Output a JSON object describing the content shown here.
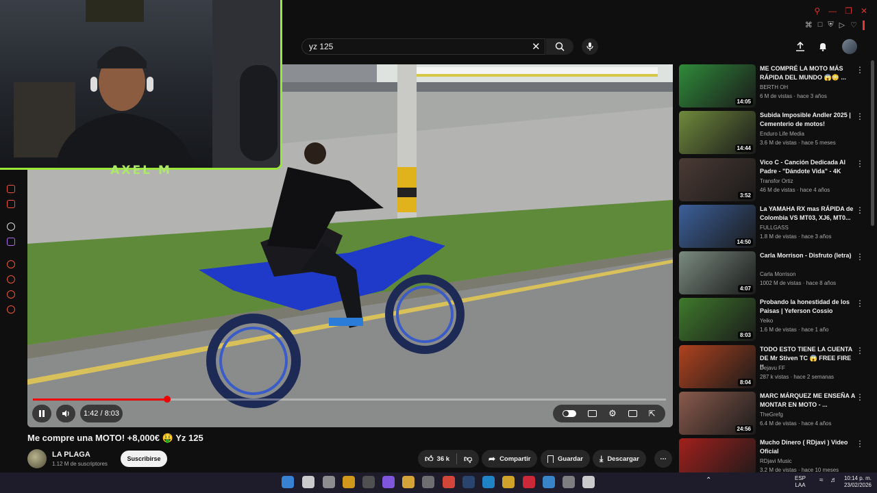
{
  "search": {
    "query": "yz 125"
  },
  "overlay": {
    "streamer_name": "AXEL M"
  },
  "player": {
    "current_time": "1:42",
    "duration": "8:03",
    "time_display": "1:42 / 8:03",
    "progress_fraction": 0.212
  },
  "video": {
    "title": "Me compre una MOTO! +8,000€ 🤑 Yz 125",
    "channel": "LA PLAGA",
    "subscribers": "1.12 M de suscriptores",
    "subscribe_label": "Suscribirse",
    "likes": "36 k",
    "share_label": "Compartir",
    "save_label": "Guardar",
    "download_label": "Descargar"
  },
  "recommendations": [
    {
      "title": "ME COMPRÉ LA MOTO MÁS RÁPIDA DEL MUNDO 😱😳 ...",
      "channel": "BERTH OH",
      "meta": "6 M de vistas · hace 3 años",
      "duration": "14:05",
      "thumb_color": "#2f8a3a"
    },
    {
      "title": "Subida Imposible Andler 2025 | Cementerio de motos!",
      "channel": "Enduro Life Media",
      "meta": "3.6 M de vistas · hace 5 meses",
      "duration": "14:44",
      "thumb_color": "#6f8a3c"
    },
    {
      "title": "Vico C - Canción Dedicada Al Padre - \"Dándote Vida\" - 4K",
      "channel": "Transfor Ortiz",
      "meta": "46 M de vistas · hace 4 años",
      "duration": "3:52",
      "thumb_color": "#4b3a34"
    },
    {
      "title": "La YAMAHA RX mas RÁPIDA de Colombia VS MT03, XJ6, MT0...",
      "channel": "FULLGASS",
      "meta": "1.8 M de vistas · hace 3 años",
      "duration": "14:50",
      "thumb_color": "#3b5f9a"
    },
    {
      "title": "Carla Morrison - Disfruto (letra)",
      "channel": "Carla Morrison",
      "meta": "1002 M de vistas · hace 8 años",
      "duration": "4:07",
      "thumb_color": "#7a8b80"
    },
    {
      "title": "Probando la honestidad de los Paisas | Yeferson Cossio",
      "channel": "Yeiko",
      "meta": "1.6 M de vistas · hace 1 año",
      "duration": "8:03",
      "thumb_color": "#3f7a2c"
    },
    {
      "title": "TODO ESTO TIENE LA CUENTA DE Mr Stiven TC 😱 FREE FIRE !!",
      "channel": "Dejavu FF",
      "meta": "287 k vistas · hace 2 semanas",
      "duration": "8:04",
      "thumb_color": "#b0421f"
    },
    {
      "title": "MARC MÁRQUEZ ME ENSEÑA A MONTAR EN MOTO - ...",
      "channel": "TheGrefg",
      "meta": "6.4 M de vistas · hace 4 años",
      "duration": "24:56",
      "thumb_color": "#8a5a4c"
    },
    {
      "title": "Mucho Dinero ( RDjavi ) Video Oficial",
      "channel": "RDjavi Music",
      "meta": "3.2 M de vistas · hace 10 meses",
      "duration": "",
      "thumb_color": "#a2201c"
    }
  ],
  "taskbar": {
    "lang_top": "ESP",
    "lang_bottom": "LAA",
    "time": "10:14 p. m.",
    "date": "23/02/2026"
  },
  "colors": {
    "accent": "#ff0000",
    "overlay_green": "#9be83a",
    "background": "#0f0f0f"
  }
}
